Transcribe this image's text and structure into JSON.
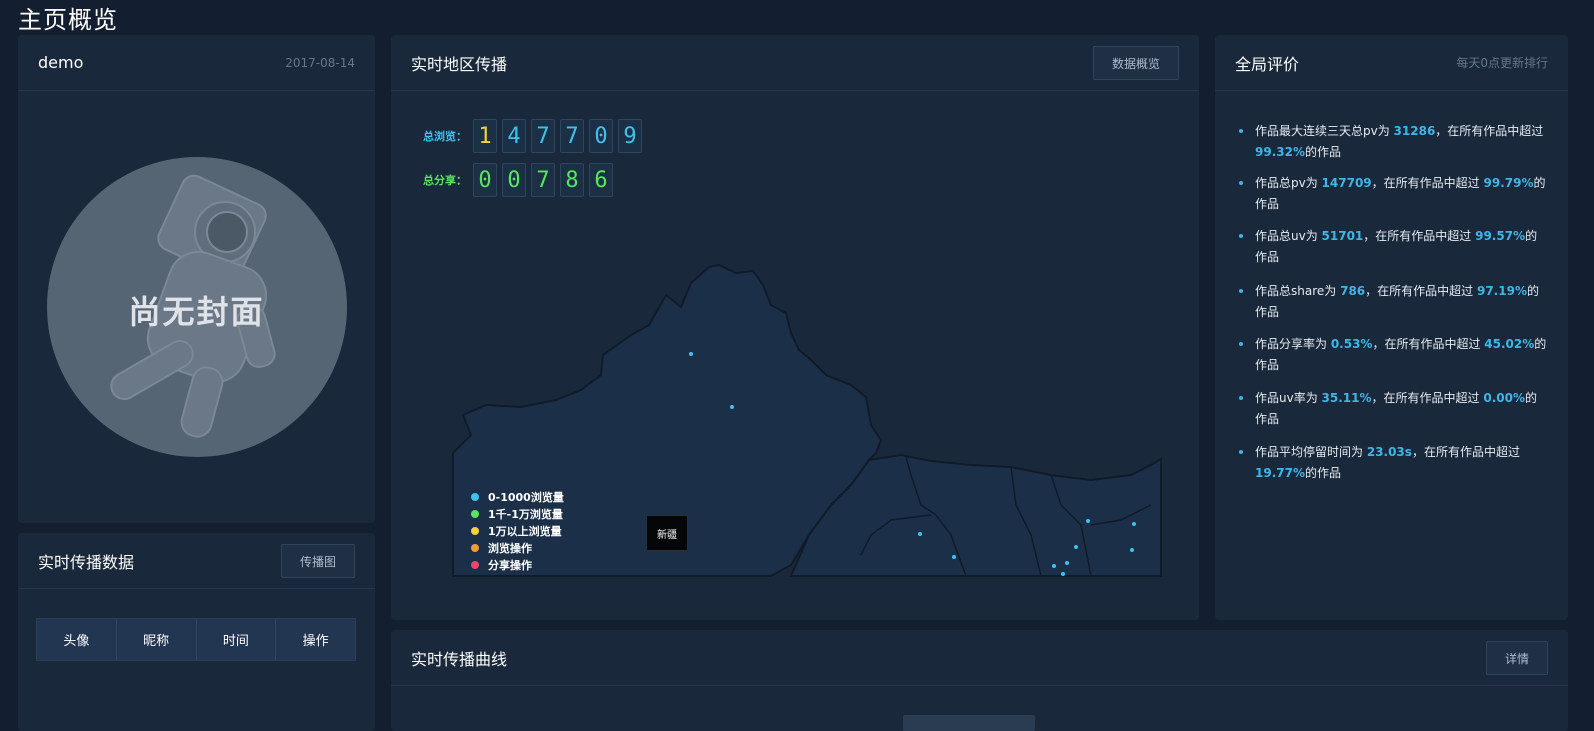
{
  "page": {
    "title": "主页概览"
  },
  "profile": {
    "name": "demo",
    "date": "2017-08-14",
    "cover_text": "尚无封面"
  },
  "realtime": {
    "title": "实时传播数据",
    "button": "传播图",
    "columns": [
      "头像",
      "昵称",
      "时间",
      "操作"
    ]
  },
  "map": {
    "title": "实时地区传播",
    "button": "数据概览",
    "views_label": "总浏览：",
    "views_digits": [
      "1",
      "4",
      "7",
      "7",
      "0",
      "9"
    ],
    "shares_label": "总分享：",
    "shares_digits": [
      "0",
      "0",
      "7",
      "8",
      "6"
    ],
    "legend": [
      {
        "label": "0-1000浏览量",
        "color": "#3fc2f2"
      },
      {
        "label": "1千-1万浏览量",
        "color": "#57e65c"
      },
      {
        "label": "1万以上浏览量",
        "color": "#f3d23d"
      },
      {
        "label": "浏览操作",
        "color": "#f09a3a"
      },
      {
        "label": "分享操作",
        "color": "#f0456a"
      }
    ],
    "tooltip": "新疆",
    "colors": {
      "views": "#3fc2f2",
      "views_first": "#f3d23d",
      "shares": "#57e65c"
    }
  },
  "eval": {
    "title": "全局评价",
    "subtitle": "每天0点更新排行",
    "items": [
      {
        "pre": "作品最大连续三天总pv为 ",
        "v1": "31286",
        "mid": "，在所有作品中超过 ",
        "v2": "99.32%",
        "post": "的作品"
      },
      {
        "pre": "作品总pv为 ",
        "v1": "147709",
        "mid": "，在所有作品中超过 ",
        "v2": "99.79%",
        "post": "的作品"
      },
      {
        "pre": "作品总uv为 ",
        "v1": "51701",
        "mid": "，在所有作品中超过 ",
        "v2": "99.57%",
        "post": "的作品"
      },
      {
        "pre": "作品总share为 ",
        "v1": "786",
        "mid": "，在所有作品中超过 ",
        "v2": "97.19%",
        "post": "的作品"
      },
      {
        "pre": "作品分享率为 ",
        "v1": "0.53%",
        "mid": "，在所有作品中超过 ",
        "v2": "45.02%",
        "post": "的作品"
      },
      {
        "pre": "作品uv率为 ",
        "v1": "35.11%",
        "mid": "，在所有作品中超过 ",
        "v2": "0.00%",
        "post": "的作品"
      },
      {
        "pre": "作品平均停留时间为 ",
        "v1": "23.03s",
        "mid": "，在所有作品中超过 ",
        "v2": "19.77%",
        "post": "的作品"
      }
    ]
  },
  "curve": {
    "title": "实时传播曲线",
    "button": "详情"
  }
}
